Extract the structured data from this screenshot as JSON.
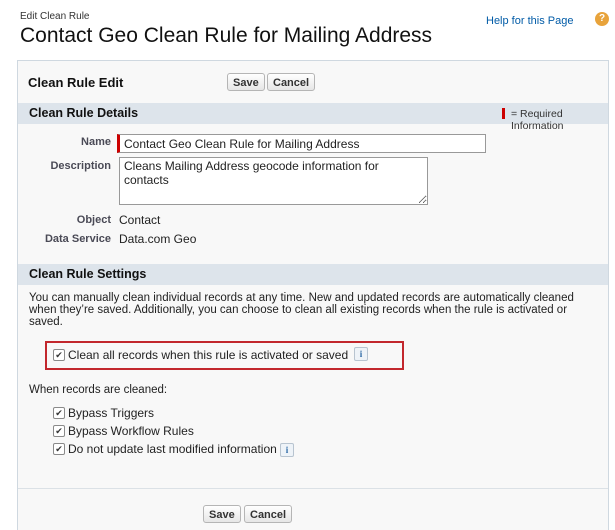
{
  "header": {
    "small_title": "Edit Clean Rule",
    "title": "Contact Geo Clean Rule for Mailing Address",
    "help_link": "Help for this Page",
    "help_icon": "?"
  },
  "edit_panel": {
    "title": "Clean Rule Edit",
    "save_label": "Save",
    "cancel_label": "Cancel"
  },
  "details": {
    "section_title": "Clean Rule Details",
    "required_info": "= Required Information",
    "name_label": "Name",
    "name_value": "Contact Geo Clean Rule for Mailing Address",
    "description_label": "Description",
    "description_value": "Cleans Mailing Address geocode information for contacts",
    "object_label": "Object",
    "object_value": "Contact",
    "data_service_label": "Data Service",
    "data_service_value": "Data.com Geo"
  },
  "settings": {
    "section_title": "Clean Rule Settings",
    "intro": "You can manually clean individual records at any time. New and updated records are automatically cleaned when they’re saved. Additionally, you can choose to clean all existing records when the rule is activated or saved.",
    "clean_all_label": "Clean all records when this rule is activated or saved",
    "clean_all_checked": true,
    "when_cleaned_label": "When records are cleaned:",
    "options": [
      {
        "label": "Bypass Triggers",
        "checked": true
      },
      {
        "label": "Bypass Workflow Rules",
        "checked": true
      },
      {
        "label": "Do not update last modified information",
        "checked": true
      }
    ],
    "info_glyph": "i"
  },
  "footer": {
    "save_label": "Save",
    "cancel_label": "Cancel"
  },
  "colors": {
    "accent_red": "#c2272d",
    "section_bg": "#dde4eb",
    "link": "#015ba7"
  }
}
